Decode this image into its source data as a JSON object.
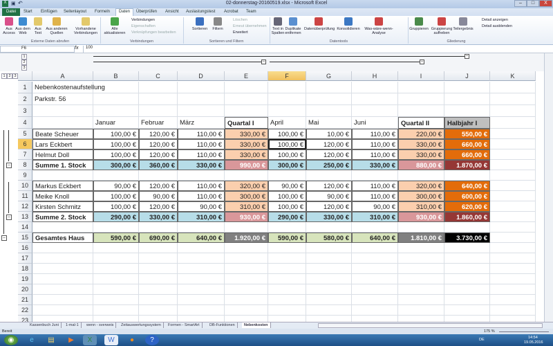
{
  "window": {
    "title": "02-donnerstag-20160519.xlsx - Microsoft Excel",
    "minimize": "–",
    "maximize": "□",
    "close": "X"
  },
  "tabs": [
    "Datei",
    "Start",
    "Einfügen",
    "Seitenlayout",
    "Formeln",
    "Daten",
    "Überprüfen",
    "Ansicht",
    "Auslastungstest",
    "Acrobat",
    "Team"
  ],
  "active_tab": "Daten",
  "ribbon": {
    "buttons": [
      "Aus Access",
      "Aus dem Web",
      "Aus Text",
      "Aus anderen Quellen",
      "Vorhandene Verbindungen",
      "Alle aktualisieren",
      "Sortieren",
      "Filtern",
      "Text in Spalten",
      "Duplikate entfernen",
      "Datenüberprüfung",
      "Konsolidieren",
      "Was-wäre-wenn-Analyse",
      "Gruppieren",
      "Gruppierung aufheben",
      "Teilergebnis"
    ],
    "small": [
      "Verbindungen",
      "Eigenschaften",
      "Verknüpfungen bearbeiten",
      "Löschen",
      "Erneut übernehmen",
      "Erweitert",
      "Detail anzeigen",
      "Detail ausblenden"
    ],
    "groups": [
      "Externe Daten abrufen",
      "Verbindungen",
      "Sortieren und Filtern",
      "Datentools",
      "Gliederung"
    ]
  },
  "formula_bar": {
    "name_box": "F6",
    "fx": "fx",
    "value": "100"
  },
  "outline_levels": [
    "1",
    "2",
    "3"
  ],
  "columns": [
    "A",
    "B",
    "C",
    "D",
    "E",
    "F",
    "G",
    "H",
    "I",
    "J",
    "K"
  ],
  "selected_column": "F",
  "selected_row": 6,
  "sheet": {
    "rows": [
      [
        "Nebenkostenaufstellung",
        "",
        "",
        "",
        "",
        "",
        "",
        "",
        "",
        "",
        ""
      ],
      [
        "Parkstr. 56",
        "",
        "",
        "",
        "",
        "",
        "",
        "",
        "",
        "",
        ""
      ],
      [
        "",
        "",
        "",
        "",
        "",
        "",
        "",
        "",
        "",
        "",
        ""
      ],
      [
        "",
        "Januar",
        "Februar",
        "März",
        "Quartal I",
        "April",
        "Mai",
        "Juni",
        "Quartal II",
        "Halbjahr I",
        ""
      ],
      [
        "Beate Scheuer",
        "100,00 €",
        "120,00 €",
        "110,00 €",
        "330,00 €",
        "100,00 €",
        "10,00 €",
        "110,00 €",
        "220,00 €",
        "550,00 €",
        ""
      ],
      [
        "Lars Eckbert",
        "100,00 €",
        "120,00 €",
        "110,00 €",
        "330,00 €",
        "100,00 €",
        "120,00 €",
        "110,00 €",
        "330,00 €",
        "660,00 €",
        ""
      ],
      [
        "Helmut Doll",
        "100,00 €",
        "120,00 €",
        "110,00 €",
        "330,00 €",
        "100,00 €",
        "120,00 €",
        "110,00 €",
        "330,00 €",
        "660,00 €",
        ""
      ],
      [
        "Summe 1. Stock",
        "300,00 €",
        "360,00 €",
        "330,00 €",
        "990,00 €",
        "300,00 €",
        "250,00 €",
        "330,00 €",
        "880,00 €",
        "1.870,00 €",
        ""
      ],
      [
        "",
        "",
        "",
        "",
        "",
        "",
        "",
        "",
        "",
        "",
        ""
      ],
      [
        "Markus Eckbert",
        "90,00 €",
        "120,00 €",
        "110,00 €",
        "320,00 €",
        "90,00 €",
        "120,00 €",
        "110,00 €",
        "320,00 €",
        "640,00 €",
        ""
      ],
      [
        "Meike Knoll",
        "100,00 €",
        "90,00 €",
        "110,00 €",
        "300,00 €",
        "100,00 €",
        "90,00 €",
        "110,00 €",
        "300,00 €",
        "600,00 €",
        ""
      ],
      [
        "Kirsten Schmitz",
        "100,00 €",
        "120,00 €",
        "90,00 €",
        "310,00 €",
        "100,00 €",
        "120,00 €",
        "90,00 €",
        "310,00 €",
        "620,00 €",
        ""
      ],
      [
        "Summe 2. Stock",
        "290,00 €",
        "330,00 €",
        "310,00 €",
        "930,00 €",
        "290,00 €",
        "330,00 €",
        "310,00 €",
        "930,00 €",
        "1.860,00 €",
        ""
      ],
      [
        "",
        "",
        "",
        "",
        "",
        "",
        "",
        "",
        "",
        "",
        ""
      ],
      [
        "Gesamtes Haus",
        "590,00 €",
        "690,00 €",
        "640,00 €",
        "1.920,00 €",
        "590,00 €",
        "580,00 €",
        "640,00 €",
        "1.810,00 €",
        "3.730,00 €",
        ""
      ],
      [
        "",
        "",
        "",
        "",
        "",
        "",
        "",
        "",
        "",
        "",
        ""
      ],
      [
        "",
        "",
        "",
        "",
        "",
        "",
        "",
        "",
        "",
        "",
        ""
      ],
      [
        "",
        "",
        "",
        "",
        "",
        "",
        "",
        "",
        "",
        "",
        ""
      ],
      [
        "",
        "",
        "",
        "",
        "",
        "",
        "",
        "",
        "",
        "",
        ""
      ],
      [
        "",
        "",
        "",
        "",
        "",
        "",
        "",
        "",
        "",
        "",
        ""
      ],
      [
        "",
        "",
        "",
        "",
        "",
        "",
        "",
        "",
        "",
        "",
        ""
      ],
      [
        "",
        "",
        "",
        "",
        "",
        "",
        "",
        "",
        "",
        "",
        ""
      ],
      [
        "",
        "",
        "",
        "",
        "",
        "",
        "",
        "",
        "",
        "",
        ""
      ]
    ]
  },
  "sheet_tabs": [
    "Kassenbuch Juni",
    "1-mal-1",
    "wenn - sverweis",
    "Zeitauswertungssystem",
    "Formen - SmartArt",
    "DB-Funktionen",
    "Nebenkosten"
  ],
  "active_sheet": "Nebenkosten",
  "status": {
    "ready": "Bereit",
    "zoom": "175 %"
  },
  "tray": {
    "lang": "DE",
    "time": "14:54",
    "date": "19.05.2016"
  },
  "colors": {
    "peach": "#fbcfae",
    "rose": "#d9979a",
    "orange": "#e36c0a",
    "darkred": "#953735",
    "lightblue": "#b7dde8",
    "green": "#d7e4bc",
    "gray": "#808080",
    "black": "#000000",
    "header_gray": "#bfbfbf"
  }
}
